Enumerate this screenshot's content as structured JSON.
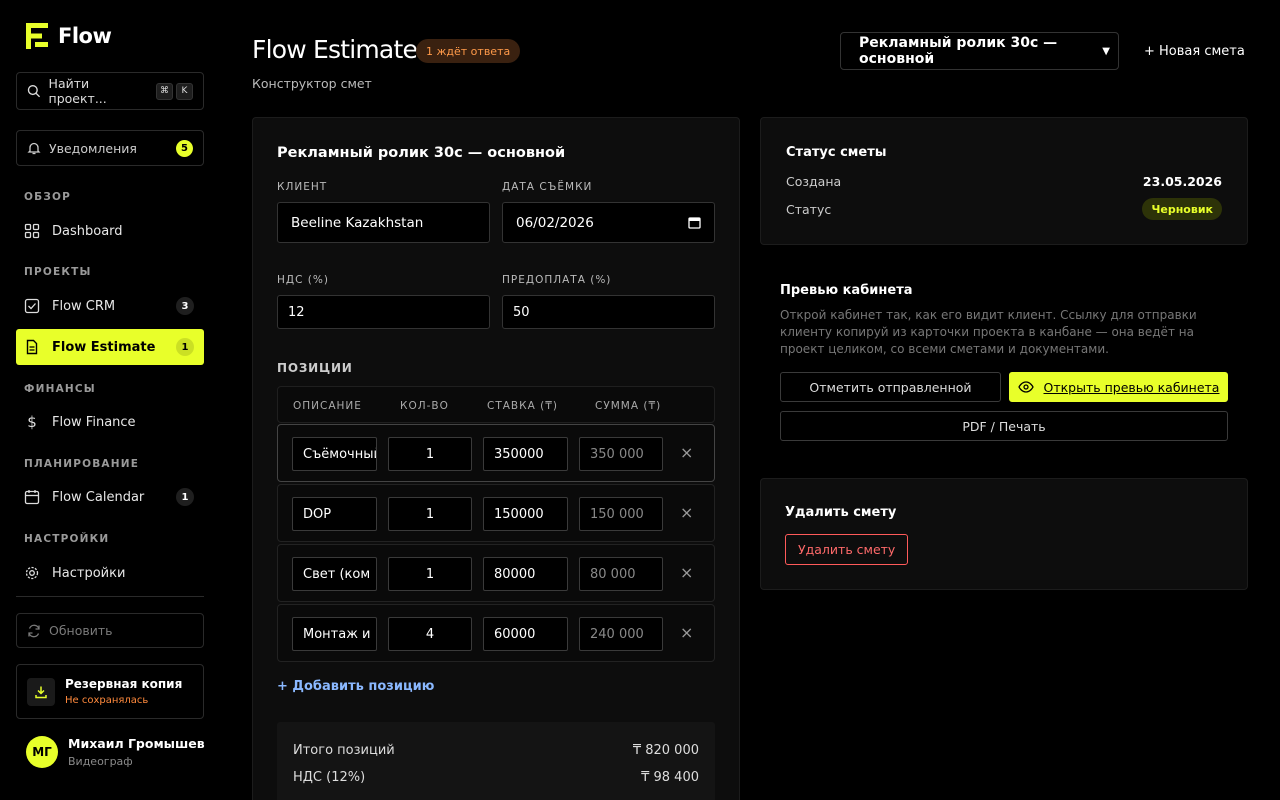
{
  "app": {
    "name": "Flow"
  },
  "search": {
    "placeholder": "Найти проект...",
    "kbd1": "⌘",
    "kbd2": "K"
  },
  "notifications": {
    "label": "Уведомления",
    "count": "5"
  },
  "sections": {
    "overview": "ОБЗОР",
    "projects": "ПРОЕКТЫ",
    "finance": "ФИНАНСЫ",
    "planning": "ПЛАНИРОВАНИЕ",
    "settings": "НАСТРОЙКИ"
  },
  "nav": {
    "dashboard": {
      "label": "Dashboard"
    },
    "crm": {
      "label": "Flow CRM",
      "count": "3"
    },
    "estimate": {
      "label": "Flow Estimate",
      "count": "1"
    },
    "finance": {
      "label": "Flow Finance"
    },
    "calendar": {
      "label": "Flow Calendar",
      "count": "1"
    },
    "settings": {
      "label": "Настройки"
    }
  },
  "refresh": {
    "label": "Обновить"
  },
  "backup": {
    "title": "Резервная копия",
    "status": "Не сохранялась"
  },
  "user": {
    "initials": "МГ",
    "name": "Михаил Громышев",
    "role": "Видеограф"
  },
  "header": {
    "title": "Flow Estimate",
    "pending": "1 ждёт ответа",
    "subtitle": "Конструктор смет",
    "selected_estimate": "Рекламный ролик 30с — основной",
    "new_estimate": "+ Новая смета"
  },
  "estimate": {
    "title": "Рекламный ролик 30с — основной",
    "client_label": "КЛИЕНТ",
    "client": "Beeline Kazakhstan",
    "date_label": "ДАТА СЪЁМКИ",
    "date": "06/02/2026",
    "vat_label": "НДС (%)",
    "vat": "12",
    "prepay_label": "ПРЕДОПЛАТА (%)",
    "prepay": "50",
    "positions_label": "ПОЗИЦИИ",
    "columns": {
      "desc": "ОПИСАНИЕ",
      "qty": "КОЛ-ВО",
      "rate": "СТАВКА (₸)",
      "sum": "СУММА (₸)"
    },
    "rows": [
      {
        "desc": "Съёмочный",
        "qty": "1",
        "rate": "350000",
        "sum": "350 000"
      },
      {
        "desc": "DOP",
        "qty": "1",
        "rate": "150000",
        "sum": "150 000"
      },
      {
        "desc": "Свет (ком",
        "qty": "1",
        "rate": "80000",
        "sum": "80 000"
      },
      {
        "desc": "Монтаж и",
        "qty": "4",
        "rate": "60000",
        "sum": "240 000"
      }
    ],
    "remove": "×",
    "add_position": "+ Добавить позицию",
    "totals": {
      "items_label": "Итого позиций",
      "items_value": "₸ 820 000",
      "vat_label": "НДС (12%)",
      "vat_value": "₸ 98 400"
    }
  },
  "status_card": {
    "title": "Статус сметы",
    "created_label": "Создана",
    "created_value": "23.05.2026",
    "status_label": "Статус",
    "status_value": "Черновик"
  },
  "preview_card": {
    "title": "Превью кабинета",
    "text": "Открой кабинет так, как его видит клиент. Ссылку для отправки клиенту копируй из карточки проекта в канбане — она ведёт на проект целиком, со всеми сметами и документами.",
    "mark_sent": "Отметить отправленной",
    "open_preview": "Открыть превью кабинета",
    "pdf": "PDF / Печать"
  },
  "delete_card": {
    "title": "Удалить смету",
    "button": "Удалить смету"
  },
  "colors": {
    "accent": "#e8ff2a",
    "danger": "#ff5a5a",
    "pending": "#ff9a4a",
    "link": "#8ab8ff"
  }
}
